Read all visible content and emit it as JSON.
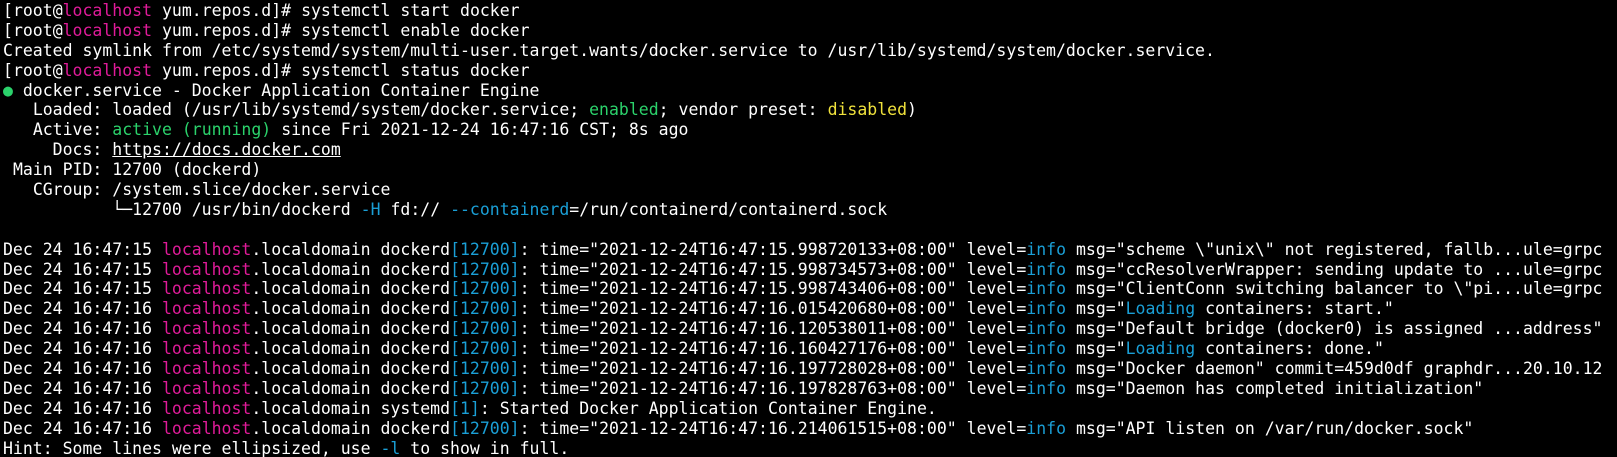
{
  "prompt_user": "root",
  "prompt_host": "localhost",
  "prompt_dir": "yum.repos.d",
  "commands": {
    "c1": "systemctl start docker",
    "c2": "systemctl enable docker",
    "c3": "systemctl status docker"
  },
  "symlink_msg": "Created symlink from /etc/systemd/system/multi-user.target.wants/docker.service to /usr/lib/systemd/system/docker.service.",
  "status": {
    "unit": "docker.service - Docker Application Container Engine",
    "loaded_label": "Loaded:",
    "loaded_pre": "loaded (/usr/lib/systemd/system/docker.service;",
    "loaded_enabled": "enabled",
    "loaded_mid": "; vendor preset:",
    "loaded_disabled": "disabled",
    "loaded_post": ")",
    "active_label": "Active:",
    "active_state": "active (running)",
    "active_since": "since Fri 2021-12-24 16:47:16 CST; 8s ago",
    "docs_label": "Docs:",
    "docs_url": "https://docs.docker.com",
    "mainpid_label": "Main PID:",
    "mainpid_value": "12700 (dockerd)",
    "cgroup_label": "CGroup:",
    "cgroup_value": "/system.slice/docker.service",
    "tree_prefix": "└─12700 /usr/bin/dockerd",
    "tree_flag1": "-H",
    "tree_mid": "fd://",
    "tree_flag2": "--containerd",
    "tree_post": "=/run/containerd/containerd.sock"
  },
  "logs": [
    {
      "date": "Dec 24 16:47:15",
      "host": "localhost",
      "domain": ".localdomain",
      "proc": "dockerd",
      "pid": "[12700]",
      "time": "time=\"2021-12-24T16:47:15.998720133+08:00\"",
      "level": "info",
      "msg": "msg=\"scheme \\\"unix\\\" not registered, fallb...ule=grpc"
    },
    {
      "date": "Dec 24 16:47:15",
      "host": "localhost",
      "domain": ".localdomain",
      "proc": "dockerd",
      "pid": "[12700]",
      "time": "time=\"2021-12-24T16:47:15.998734573+08:00\"",
      "level": "info",
      "msg": "msg=\"ccResolverWrapper: sending update to ...ule=grpc"
    },
    {
      "date": "Dec 24 16:47:15",
      "host": "localhost",
      "domain": ".localdomain",
      "proc": "dockerd",
      "pid": "[12700]",
      "time": "time=\"2021-12-24T16:47:15.998743406+08:00\"",
      "level": "info",
      "msg": "msg=\"ClientConn switching balancer to \\\"pi...ule=grpc"
    },
    {
      "date": "Dec 24 16:47:16",
      "host": "localhost",
      "domain": ".localdomain",
      "proc": "dockerd",
      "pid": "[12700]",
      "time": "time=\"2021-12-24T16:47:16.015420680+08:00\"",
      "level": "info",
      "msg_pre": "msg=\"",
      "msg_hl": "Loading",
      "msg_post": " containers: start.\""
    },
    {
      "date": "Dec 24 16:47:16",
      "host": "localhost",
      "domain": ".localdomain",
      "proc": "dockerd",
      "pid": "[12700]",
      "time": "time=\"2021-12-24T16:47:16.120538011+08:00\"",
      "level": "info",
      "msg": "msg=\"Default bridge (docker0) is assigned ...address\""
    },
    {
      "date": "Dec 24 16:47:16",
      "host": "localhost",
      "domain": ".localdomain",
      "proc": "dockerd",
      "pid": "[12700]",
      "time": "time=\"2021-12-24T16:47:16.160427176+08:00\"",
      "level": "info",
      "msg_pre": "msg=\"",
      "msg_hl": "Loading",
      "msg_post": " containers: done.\""
    },
    {
      "date": "Dec 24 16:47:16",
      "host": "localhost",
      "domain": ".localdomain",
      "proc": "dockerd",
      "pid": "[12700]",
      "time": "time=\"2021-12-24T16:47:16.197728028+08:00\"",
      "level": "info",
      "msg": "msg=\"Docker daemon\" commit=459d0df graphdr...20.10.12"
    },
    {
      "date": "Dec 24 16:47:16",
      "host": "localhost",
      "domain": ".localdomain",
      "proc": "dockerd",
      "pid": "[12700]",
      "time": "time=\"2021-12-24T16:47:16.197828763+08:00\"",
      "level": "info",
      "msg": "msg=\"Daemon has completed initialization\""
    }
  ],
  "systemd_line": {
    "date": "Dec 24 16:47:16",
    "host": "localhost",
    "domain": ".localdomain",
    "proc": "systemd",
    "pid": "[1]",
    "msg": ": Started Docker Application Container Engine."
  },
  "last_log": {
    "date": "Dec 24 16:47:16",
    "host": "localhost",
    "domain": ".localdomain",
    "proc": "dockerd",
    "pid": "[12700]",
    "time": "time=\"2021-12-24T16:47:16.214061515+08:00\"",
    "level": "info",
    "msg": "msg=\"API listen on /var/run/docker.sock\""
  },
  "hint": {
    "pre": "Hint: Some lines were ellipsized, use ",
    "flag": "-l",
    "post": " to show in full."
  },
  "colors": {
    "host": "#e01b99",
    "pid": "#1a9fd6",
    "green": "#2bd26b",
    "yellow": "#f0e23c",
    "background": "#000000",
    "text": "#ffffff"
  }
}
